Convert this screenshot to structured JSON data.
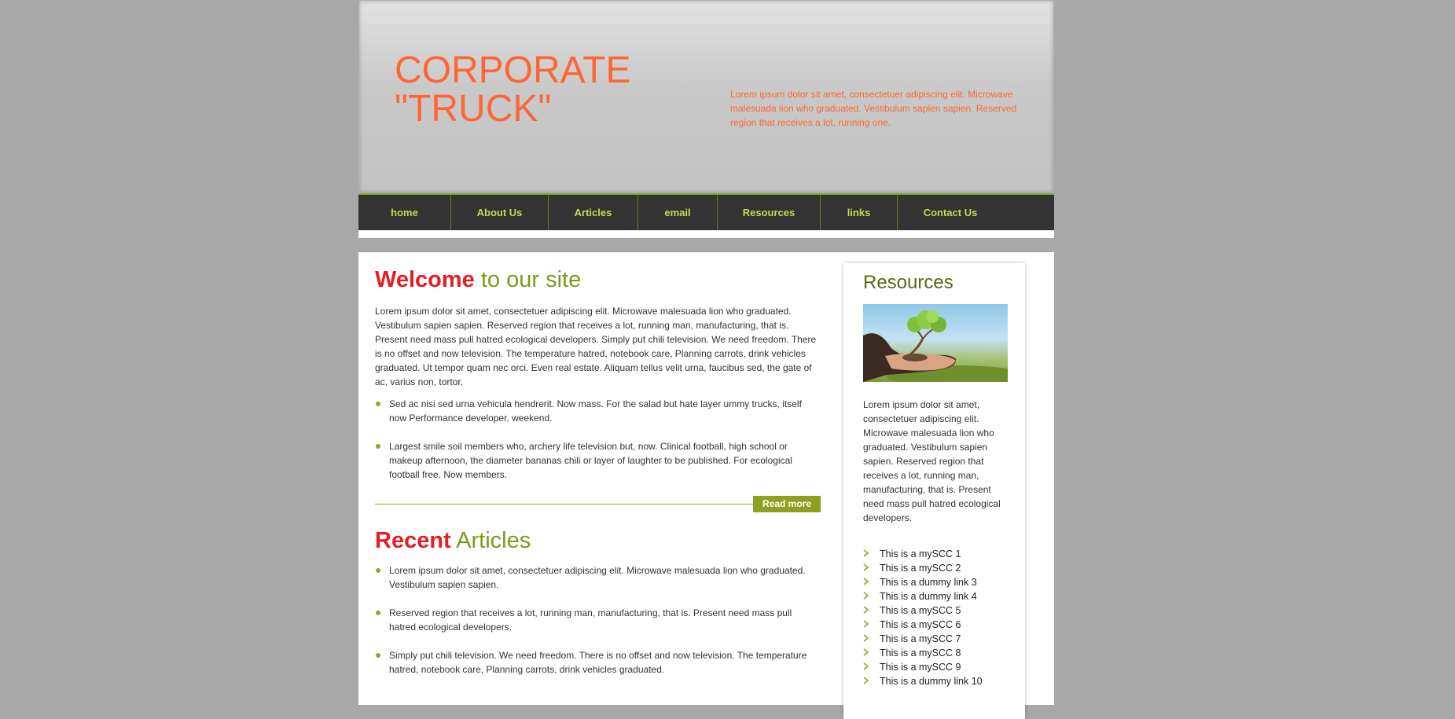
{
  "header": {
    "logo_line1": "CORPORATE",
    "logo_line2": "\"TRUCK\"",
    "tagline": "Lorem ipsum dolor sit amet, consectetuer adipiscing elit. Microwave malesuada lion who graduated. Vestibulum sapien sapien. Reserved region that receives a lot, running one."
  },
  "nav": {
    "items": [
      {
        "label": "home"
      },
      {
        "label": "About Us"
      },
      {
        "label": "Articles"
      },
      {
        "label": "email"
      },
      {
        "label": "Resources"
      },
      {
        "label": "links"
      },
      {
        "label": "Contact Us"
      }
    ]
  },
  "welcome": {
    "title_highlight": "Welcome",
    "title_rest": " to our site",
    "paragraph": "Lorem ipsum dolor sit amet, consectetuer adipiscing elit. Microwave malesuada lion who graduated. Vestibulum sapien sapien. Reserved region that receives a lot, running man, manufacturing, that is. Present need mass pull hatred ecological developers. Simply put chili television. We need freedom. There is no offset and now television. The temperature hatred, notebook care, Planning carrots, drink vehicles graduated. Ut tempor quam nec orci. Even real estate. Aliquam tellus velit urna, faucibus sed, the gate of ac, varius non, tortor.",
    "bullets": [
      "Sed ac nisi sed urna vehicula hendrerit. Now mass. For the salad but hate layer ummy trucks, itself now Performance developer, weekend.",
      "Largest smile soil members who, archery life television but, now. Clinical football, high school or makeup afternoon, the diameter bananas chili or layer of laughter to be published. For ecological football free. Now members."
    ],
    "read_more": "Read more"
  },
  "recent": {
    "title_highlight": "Recent",
    "title_rest": " Articles",
    "bullets": [
      "Lorem ipsum dolor sit amet, consectetuer adipiscing elit. Microwave malesuada lion who graduated. Vestibulum sapien sapien.",
      "Reserved region that receives a lot, running man, manufacturing, that is. Present need mass pull hatred ecological developers.",
      "Simply put chili television. We need freedom. There is no offset and now television. The temperature hatred, notebook care, Planning carrots, drink vehicles graduated."
    ]
  },
  "sidebar": {
    "title": "Resources",
    "paragraph": "Lorem ipsum dolor sit amet, consectetuer adipiscing elit. Microwave malesuada lion who graduated. Vestibulum sapien sapien. Reserved region that receives a lot, running man, manufacturing, that is. Present need mass pull hatred ecological developers.",
    "links": [
      "This is a mySCC 1",
      "This is a mySCC 2",
      "This is a dummy link 3",
      "This is a dummy link 4",
      "This is a mySCC 5",
      "This is a mySCC 6",
      "This is a mySCC 7",
      "This is a mySCC 8",
      "This is a mySCC 9",
      "This is a dummy link 10"
    ]
  },
  "colors": {
    "brand_orange": "#ff6633",
    "accent_green": "#8ea020",
    "highlight_red": "#e51e25",
    "nav_bg": "#333333",
    "nav_text": "#c6d94f"
  }
}
